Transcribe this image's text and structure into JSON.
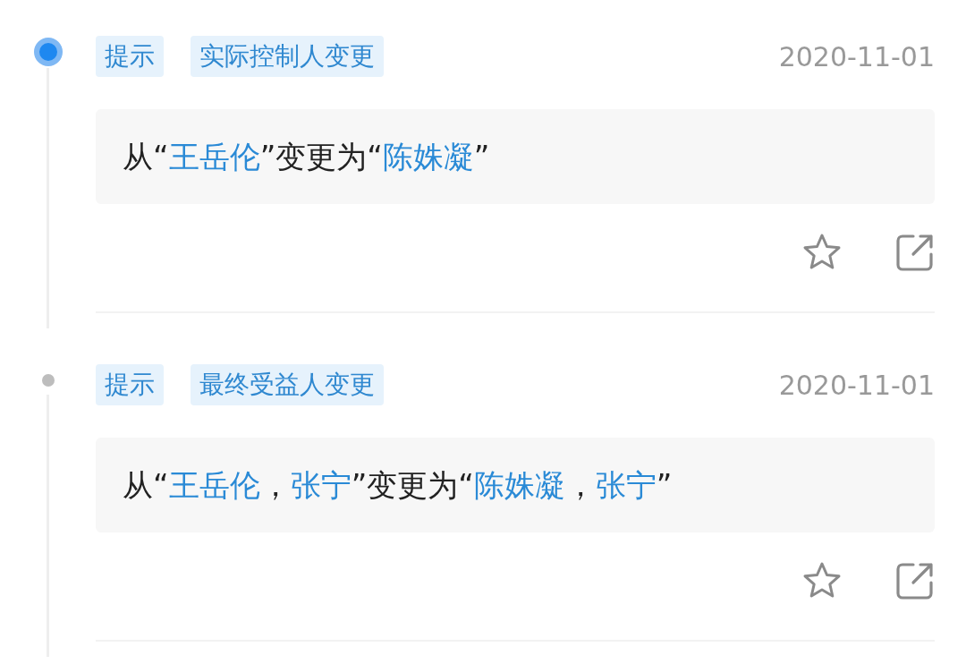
{
  "entries": [
    {
      "current": true,
      "tags": [
        "提示",
        "实际控制人变更"
      ],
      "date": "2020-11-01",
      "change": [
        {
          "kind": "text",
          "text": "从“"
        },
        {
          "kind": "link",
          "text": "王岳伦"
        },
        {
          "kind": "text",
          "text": "”变更为“"
        },
        {
          "kind": "link",
          "text": "陈姝凝"
        },
        {
          "kind": "text",
          "text": "”"
        }
      ],
      "favorited": false
    },
    {
      "current": false,
      "tags": [
        "提示",
        "最终受益人变更"
      ],
      "date": "2020-11-01",
      "change": [
        {
          "kind": "text",
          "text": "从“"
        },
        {
          "kind": "link",
          "text": "王岳伦",
          "after": "，"
        },
        {
          "kind": "link",
          "text": "张宁"
        },
        {
          "kind": "text",
          "text": "”变更为“"
        },
        {
          "kind": "link",
          "text": "陈姝凝",
          "after": "，"
        },
        {
          "kind": "link",
          "text": "张宁"
        },
        {
          "kind": "text",
          "text": "”"
        }
      ],
      "favorited": false
    }
  ]
}
